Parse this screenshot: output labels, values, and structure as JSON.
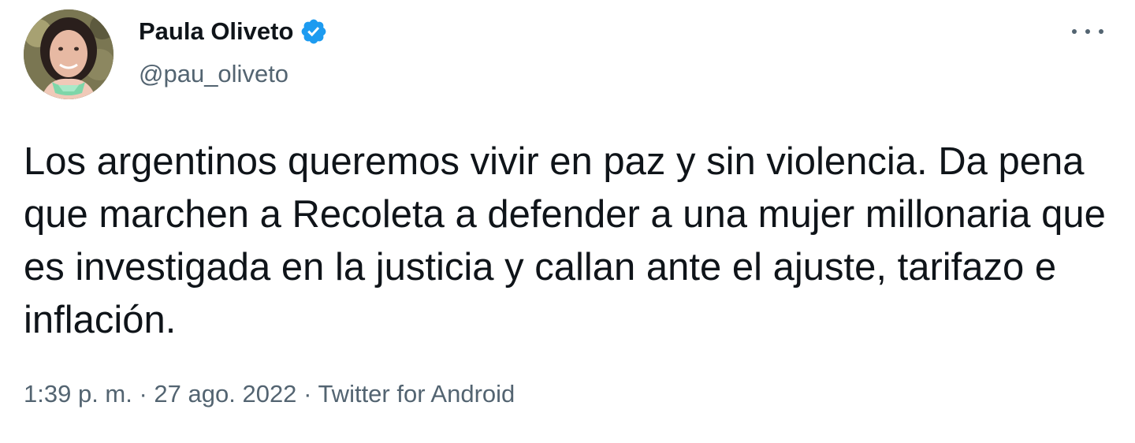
{
  "author": {
    "display_name": "Paula Oliveto",
    "handle": "@pau_oliveto",
    "verified": true
  },
  "tweet": {
    "text": "Los argentinos queremos vivir en paz y sin violencia. Da pena que marchen a Recoleta a defender a una mujer millonaria que es investigada en la justicia y callan ante el ajuste, tarifazo e inflación.",
    "time": "1:39 p. m.",
    "separator": "·",
    "date": "27 ago. 2022",
    "source": "Twitter for Android"
  },
  "icons": {
    "verified": "verified-badge-icon",
    "more": "more-options-icon"
  },
  "colors": {
    "text_primary": "#0f1419",
    "text_secondary": "#536471",
    "verified_blue": "#1d9bf0"
  }
}
